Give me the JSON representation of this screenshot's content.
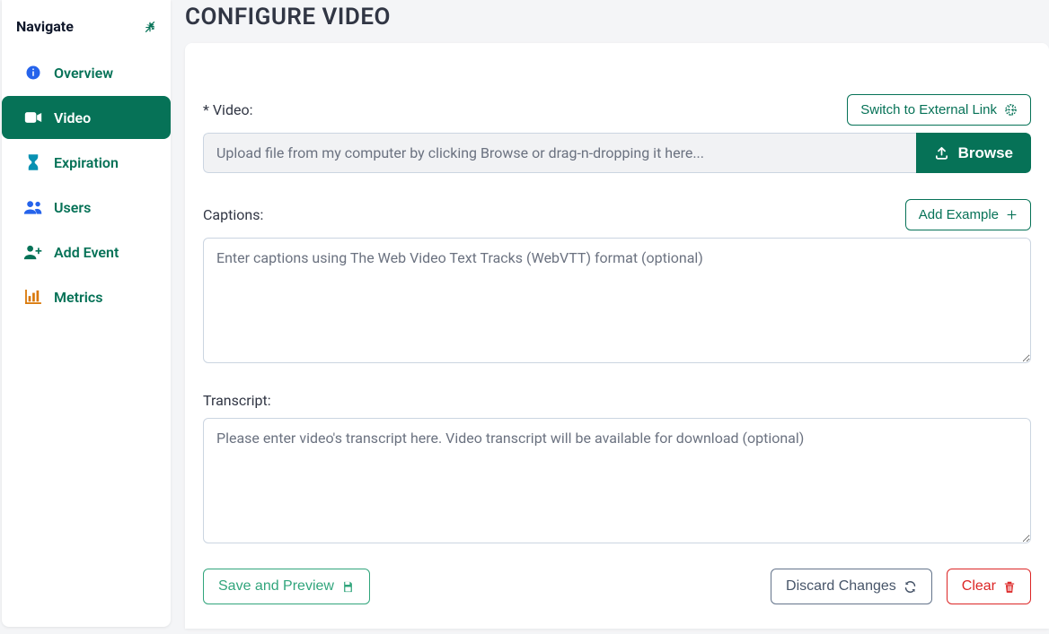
{
  "sidebar": {
    "title": "Navigate",
    "items": [
      {
        "label": "Overview",
        "icon": "info-circle-icon"
      },
      {
        "label": "Video",
        "icon": "video-camera-icon"
      },
      {
        "label": "Expiration",
        "icon": "hourglass-icon"
      },
      {
        "label": "Users",
        "icon": "users-icon"
      },
      {
        "label": "Add Event",
        "icon": "user-plus-icon"
      },
      {
        "label": "Metrics",
        "icon": "bar-chart-icon"
      }
    ],
    "activeIndex": 1
  },
  "page": {
    "title": "CONFIGURE VIDEO"
  },
  "video": {
    "label": "* Video:",
    "external_link_label": "Switch to External Link",
    "upload_placeholder": "Upload file from my computer by clicking Browse or drag-n-dropping it here...",
    "browse_label": "Browse"
  },
  "captions": {
    "label": "Captions:",
    "add_example_label": "Add Example",
    "placeholder": "Enter captions using The Web Video Text Tracks (WebVTT) format (optional)",
    "value": ""
  },
  "transcript": {
    "label": "Transcript:",
    "placeholder": "Please enter video's transcript here. Video transcript will be available for download (optional)",
    "value": ""
  },
  "actions": {
    "save_label": "Save and Preview",
    "discard_label": "Discard Changes",
    "clear_label": "Clear"
  }
}
